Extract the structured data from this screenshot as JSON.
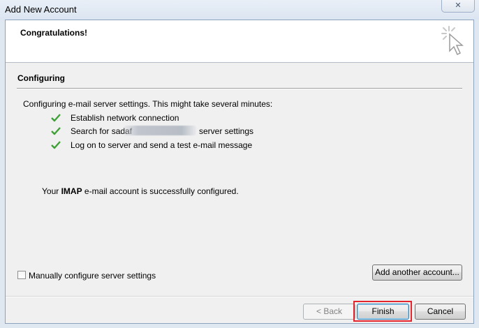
{
  "window": {
    "title": "Add New Account",
    "close_label": "✕"
  },
  "header": {
    "heading": "Congratulations!",
    "icon": "wizard-cursor-icon"
  },
  "section": {
    "title": "Configuring"
  },
  "description": "Configuring e-mail server settings. This might take several minutes:",
  "steps": [
    {
      "label": "Establish network connection",
      "status": "done"
    },
    {
      "label": "Search for sadaf",
      "label_suffix": "server settings",
      "status": "done"
    },
    {
      "label": "Log on to server and send a test e-mail message",
      "status": "done"
    }
  ],
  "success": {
    "prefix": "Your ",
    "protocol": "IMAP",
    "suffix": " e-mail account is successfully configured."
  },
  "manual_config": {
    "label": "Manually configure server settings",
    "checked": false
  },
  "buttons": {
    "add_another": "Add another account...",
    "back": "< Back",
    "finish": "Finish",
    "cancel": "Cancel"
  },
  "colors": {
    "check": "#3ea037",
    "highlight": "#e3262e"
  }
}
